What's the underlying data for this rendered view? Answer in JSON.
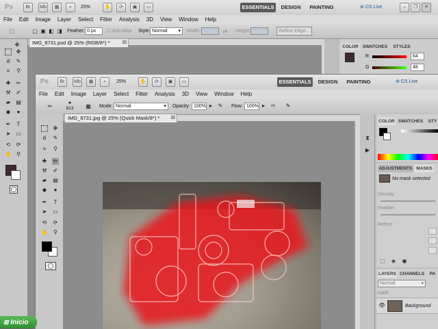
{
  "back_window": {
    "logo": "Ps",
    "zoom": "25%",
    "workspaces": [
      "ESSENTIALS",
      "DESIGN",
      "PAINTING"
    ],
    "cs_live": "CS Live",
    "menu": [
      "File",
      "Edit",
      "Image",
      "Layer",
      "Select",
      "Filter",
      "Analysis",
      "3D",
      "View",
      "Window",
      "Help"
    ],
    "options": {
      "feather_label": "Feather:",
      "feather_value": "0 px",
      "antialias_label": "Anti-alias",
      "style_label": "Style:",
      "style_value": "Normal",
      "width_label": "Width:",
      "height_label": "Height:",
      "refine_edge": "Refine Edge..."
    },
    "doc_tab": "IMG_8731.psd @ 25% (RGB/8*) *",
    "panel_tabs": [
      "COLOR",
      "SWATCHES",
      "STYLES"
    ],
    "color_rows": [
      {
        "label": "R",
        "value": "64"
      },
      {
        "label": "G",
        "value": "48"
      }
    ]
  },
  "front_window": {
    "logo": "Ps",
    "zoom": "25%",
    "workspaces": [
      "ESSENTIALS",
      "DESIGN",
      "PAINTING"
    ],
    "cs_live": "CS Live",
    "menu": [
      "File",
      "Edit",
      "Image",
      "Layer",
      "Select",
      "Filter",
      "Analysis",
      "3D",
      "View",
      "Window",
      "Help"
    ],
    "options": {
      "brush_size": "813",
      "mode_label": "Mode:",
      "mode_value": "Normal",
      "opacity_label": "Opacity:",
      "opacity_value": "100%",
      "flow_label": "Flow:",
      "flow_value": "100%"
    },
    "doc_tab": "IMG_8731.jpg @ 25% (Quick Mask/8*) *",
    "color_tabs": [
      "COLOR",
      "SWATCHES",
      "STY"
    ],
    "adjustments_tabs": [
      "ADJUSTMENTS",
      "MASKS"
    ],
    "mask_status": "No mask selected",
    "mask_fields": [
      "Density:",
      "Feather:",
      "Refine:"
    ],
    "layers_tabs": [
      "LAYERS",
      "CHANNELS",
      "PA"
    ],
    "blend_mode": "Normal",
    "lock_label": "Lock:",
    "layer_name": "Background"
  },
  "taskbar": {
    "start_label": "Inicio"
  },
  "colors": {
    "mask_red": "#e8191c",
    "foreground": "#3d2a30"
  }
}
